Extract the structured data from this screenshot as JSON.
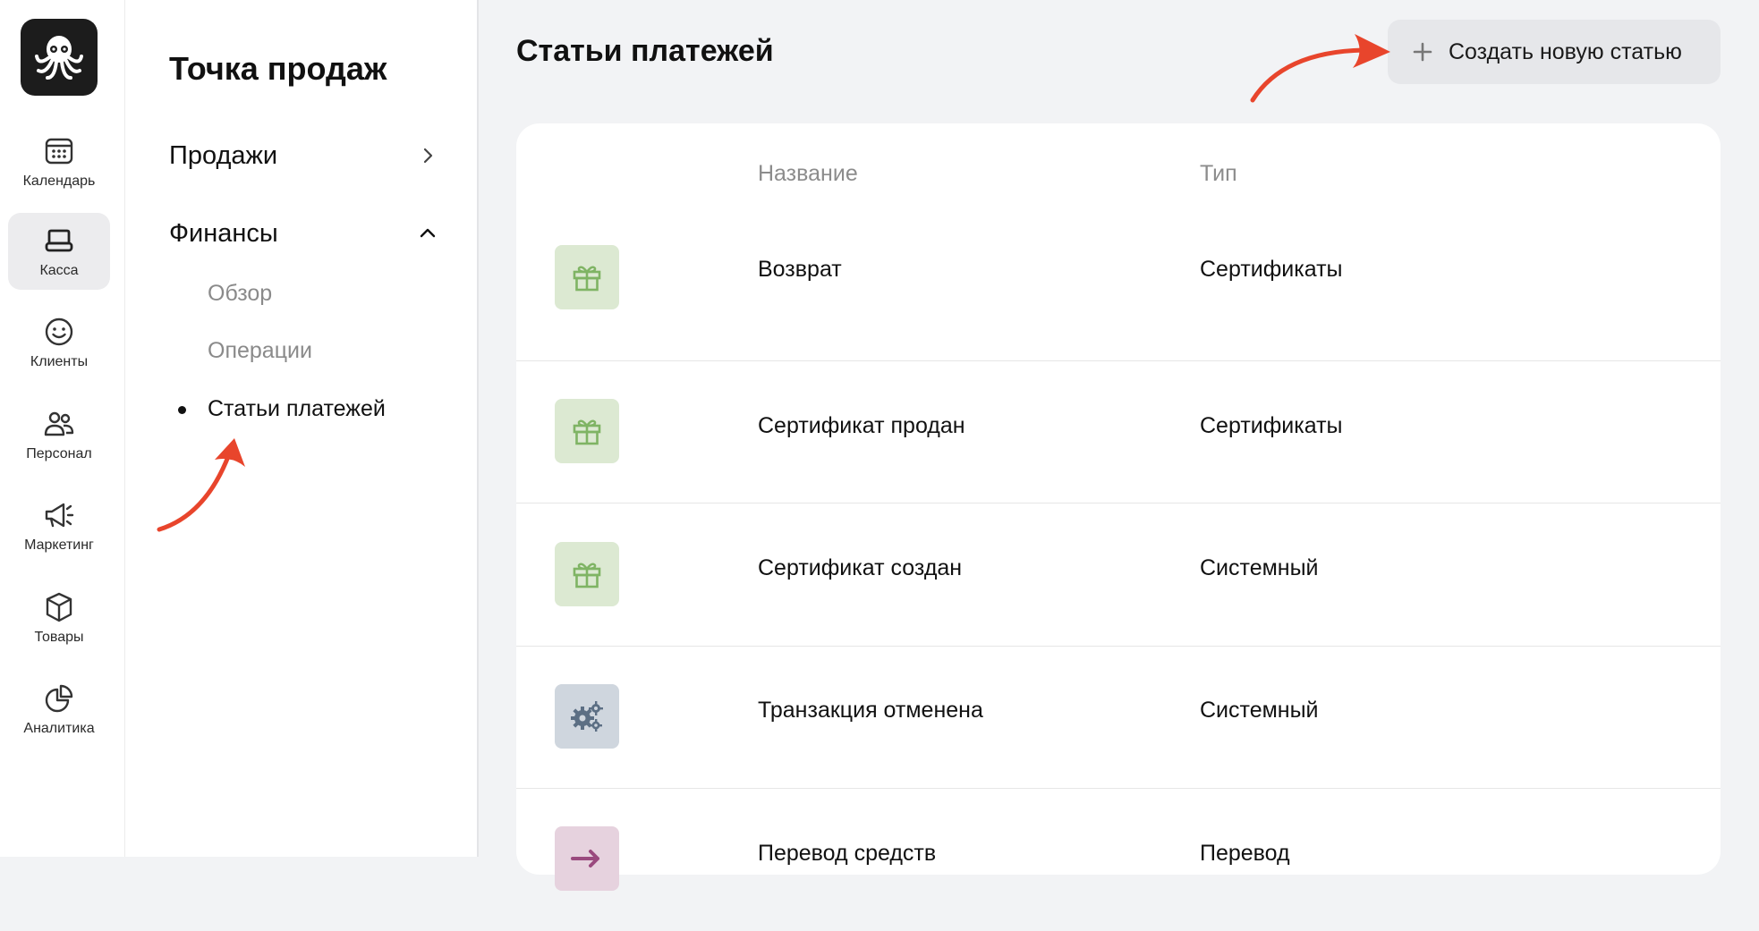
{
  "rail": {
    "items": [
      {
        "label": "Календарь",
        "icon": "calendar-icon"
      },
      {
        "label": "Касса",
        "icon": "cash-register-icon",
        "active": true
      },
      {
        "label": "Клиенты",
        "icon": "smiley-icon"
      },
      {
        "label": "Персонал",
        "icon": "staff-icon"
      },
      {
        "label": "Маркетинг",
        "icon": "megaphone-icon"
      },
      {
        "label": "Товары",
        "icon": "box-icon"
      },
      {
        "label": "Аналитика",
        "icon": "pie-chart-icon"
      }
    ]
  },
  "menu": {
    "title": "Точка продаж",
    "groups": [
      {
        "label": "Продажи",
        "expanded": false
      },
      {
        "label": "Финансы",
        "expanded": true
      }
    ],
    "finance_items": [
      {
        "label": "Обзор"
      },
      {
        "label": "Операции"
      },
      {
        "label": "Статьи платежей",
        "current": true
      }
    ]
  },
  "main": {
    "title": "Статьи платежей",
    "create_button": "Создать новую статью",
    "table": {
      "headers": {
        "name": "Название",
        "type": "Тип"
      },
      "rows": [
        {
          "icon": "gift-icon",
          "name": "Возврат",
          "type": "Сертификаты"
        },
        {
          "icon": "gift-icon",
          "name": "Сертификат продан",
          "type": "Сертификаты"
        },
        {
          "icon": "gift-icon",
          "name": "Сертификат создан",
          "type": "Системный"
        },
        {
          "icon": "gears-icon",
          "name": "Транзакция отменена",
          "type": "Системный"
        },
        {
          "icon": "arrow-right-icon",
          "name": "Перевод средств",
          "type": "Перевод"
        }
      ]
    }
  },
  "colors": {
    "accent_arrow": "#e8452c",
    "gift_bg": "#dce9d2",
    "gift_fg": "#7fb464",
    "gears_bg": "#cfd6de",
    "gears_fg": "#5c6f84",
    "transfer_bg": "#e6d2de",
    "transfer_fg": "#9a4a7e"
  }
}
